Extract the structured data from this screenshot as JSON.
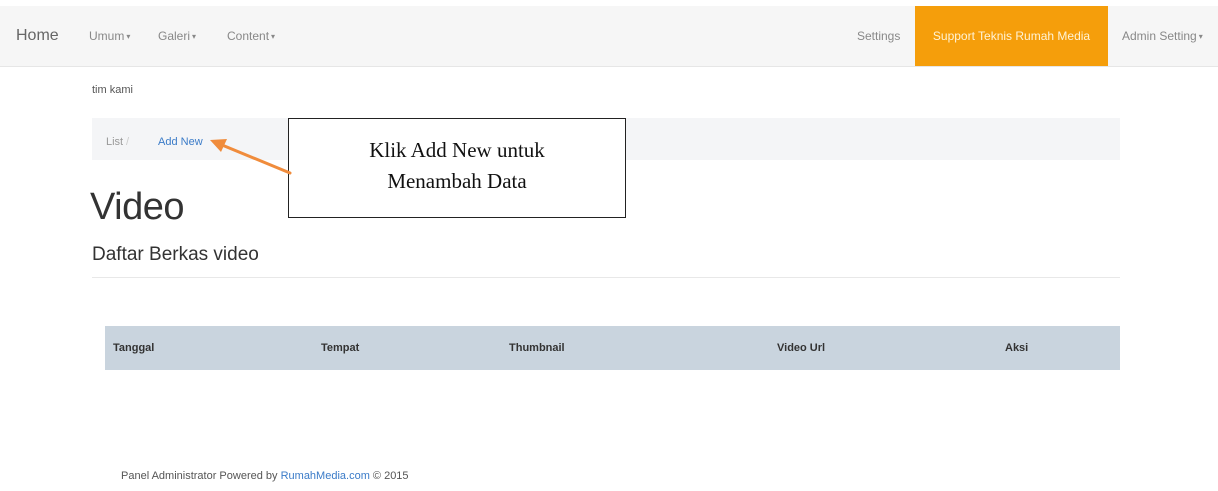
{
  "nav": {
    "home": "Home",
    "umum": "Umum",
    "galeri": "Galeri",
    "content": "Content",
    "settings": "Settings",
    "support": "Support Teknis Rumah Media",
    "admin": "Admin Setting"
  },
  "org_text": "tim kami",
  "breadcrumb": {
    "list": "List",
    "separator": "/",
    "add_new": "Add New"
  },
  "page_title": "Video",
  "section_title": "Daftar Berkas video",
  "table": {
    "columns": [
      "Tanggal",
      "Tempat",
      "Thumbnail",
      "Video Url",
      "Aksi"
    ]
  },
  "footer": {
    "prefix": "Panel Administrator Powered by ",
    "link": "RumahMedia.com",
    "suffix": " © 2015"
  },
  "annotation": {
    "line1": "Klik Add New untuk",
    "line2": "Menambah Data"
  },
  "colors": {
    "support_bg": "#f59e0b",
    "table_header_bg": "#c9d4de",
    "arrow": "#f08c3c",
    "link": "#3a7bc8"
  }
}
